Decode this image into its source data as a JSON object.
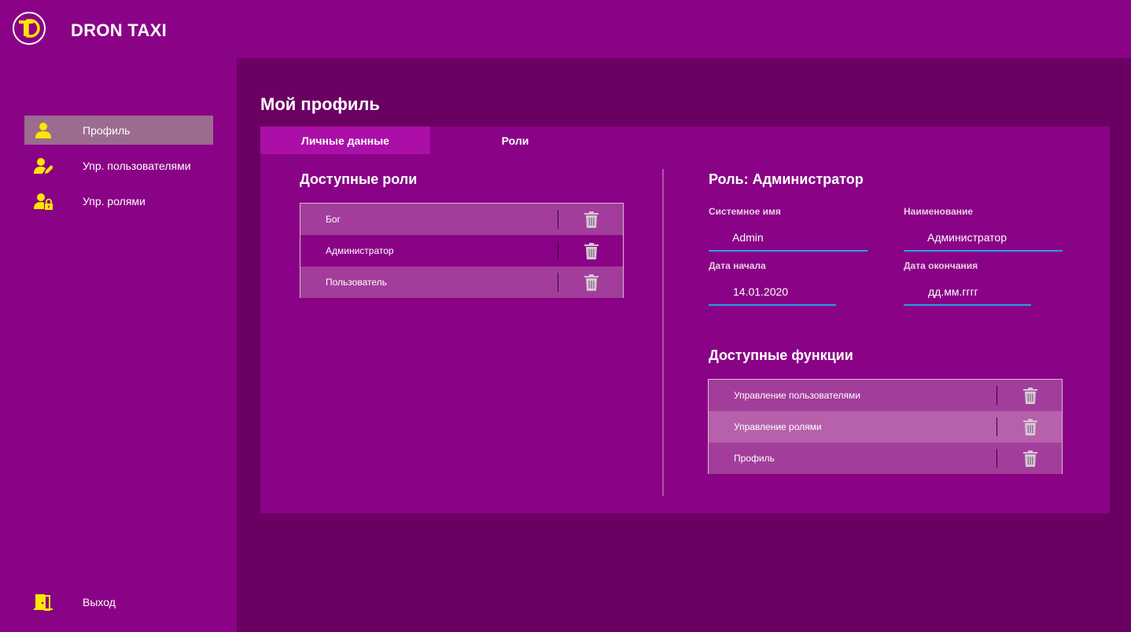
{
  "app": {
    "title": "DRON TAXI",
    "logo_icon": "dron-taxi-logo"
  },
  "sidebar": {
    "items": [
      {
        "label": "Профиль",
        "icon": "user-icon",
        "active": true
      },
      {
        "label": "Упр. пользователями",
        "icon": "user-edit-icon",
        "active": false
      },
      {
        "label": "Упр. ролями",
        "icon": "user-lock-icon",
        "active": false
      }
    ],
    "logout": {
      "label": "Выход",
      "icon": "exit-door-icon"
    }
  },
  "page": {
    "title": "Мой профиль"
  },
  "tabs": [
    {
      "label": "Личные данные",
      "active": true
    },
    {
      "label": "Роли",
      "active": false
    }
  ],
  "roles_panel": {
    "title": "Доступные роли",
    "items": [
      {
        "label": "Бог"
      },
      {
        "label": "Администратор"
      },
      {
        "label": "Пользователь"
      }
    ]
  },
  "role_detail": {
    "title": "Роль: Администратор",
    "fields": {
      "system_name": {
        "label": "Системное имя",
        "value": "Admin"
      },
      "name": {
        "label": "Наименование",
        "value": "Администратор"
      },
      "start_date": {
        "label": "Дата начала",
        "value": "14.01.2020"
      },
      "end_date": {
        "label": "Дата окончания",
        "placeholder": "дд.мм.гггг"
      }
    }
  },
  "functions_panel": {
    "title": "Доступные функции",
    "items": [
      {
        "label": "Управление пользователями"
      },
      {
        "label": "Управление ролями"
      },
      {
        "label": "Профиль"
      }
    ]
  },
  "colors": {
    "primary": "#8a0286",
    "content_bg": "#6b0063",
    "tab_active": "#ac0ea8",
    "accent_yellow": "#ffe600",
    "input_underline": "#1fa3e6"
  }
}
